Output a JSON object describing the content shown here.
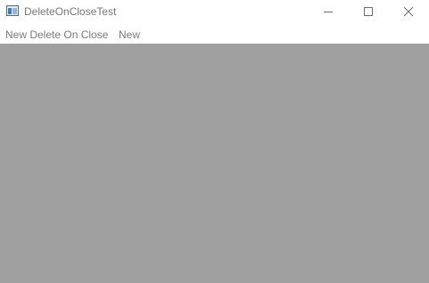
{
  "window": {
    "title": "DeleteOnCloseTest",
    "app_icon": "window-app-icon",
    "controls": {
      "minimize_icon": "minimize-icon",
      "maximize_icon": "maximize-icon",
      "close_icon": "close-icon"
    }
  },
  "menubar": {
    "items": [
      {
        "label": "New Delete On Close"
      },
      {
        "label": "New"
      }
    ]
  },
  "colors": {
    "client_background": "#a0a0a0",
    "menu_text": "#7a7a7a",
    "title_text": "#777777"
  }
}
